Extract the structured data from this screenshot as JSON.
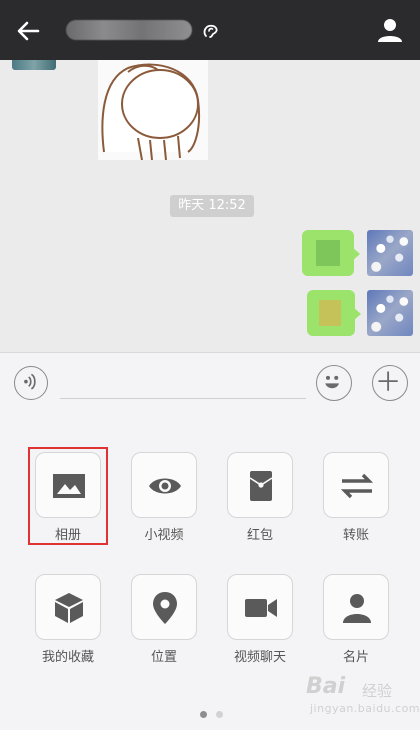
{
  "header": {
    "back_icon": "arrow-left-icon",
    "contact_name_blurred": "",
    "earpiece_icon": "ear-icon",
    "profile_icon": "person-icon"
  },
  "chat": {
    "timestamp": "昨天 12:52",
    "messages": [
      {
        "side": "right",
        "type": "text-blurred"
      },
      {
        "side": "right",
        "type": "text-blurred"
      }
    ]
  },
  "input_bar": {
    "voice_icon": "voice-icon",
    "emoji_icon": "smiley-icon",
    "more_icon": "plus-icon",
    "text_value": ""
  },
  "panel": {
    "items": [
      {
        "label": "相册",
        "icon": "image-icon"
      },
      {
        "label": "小视频",
        "icon": "eye-icon"
      },
      {
        "label": "红包",
        "icon": "red-envelope-icon"
      },
      {
        "label": "转账",
        "icon": "transfer-icon"
      },
      {
        "label": "我的收藏",
        "icon": "cube-icon"
      },
      {
        "label": "位置",
        "icon": "location-pin-icon"
      },
      {
        "label": "视频聊天",
        "icon": "video-camera-icon"
      },
      {
        "label": "名片",
        "icon": "contact-card-icon"
      }
    ],
    "page_count": 2,
    "current_page": 1
  },
  "watermark": {
    "brand": "Bai",
    "text": "经验",
    "url": "jingyan.baidu.com"
  },
  "colors": {
    "topbar": "#2b2b2d",
    "bubble": "#9be36b",
    "highlight": "#e03232",
    "icon": "#555555"
  }
}
